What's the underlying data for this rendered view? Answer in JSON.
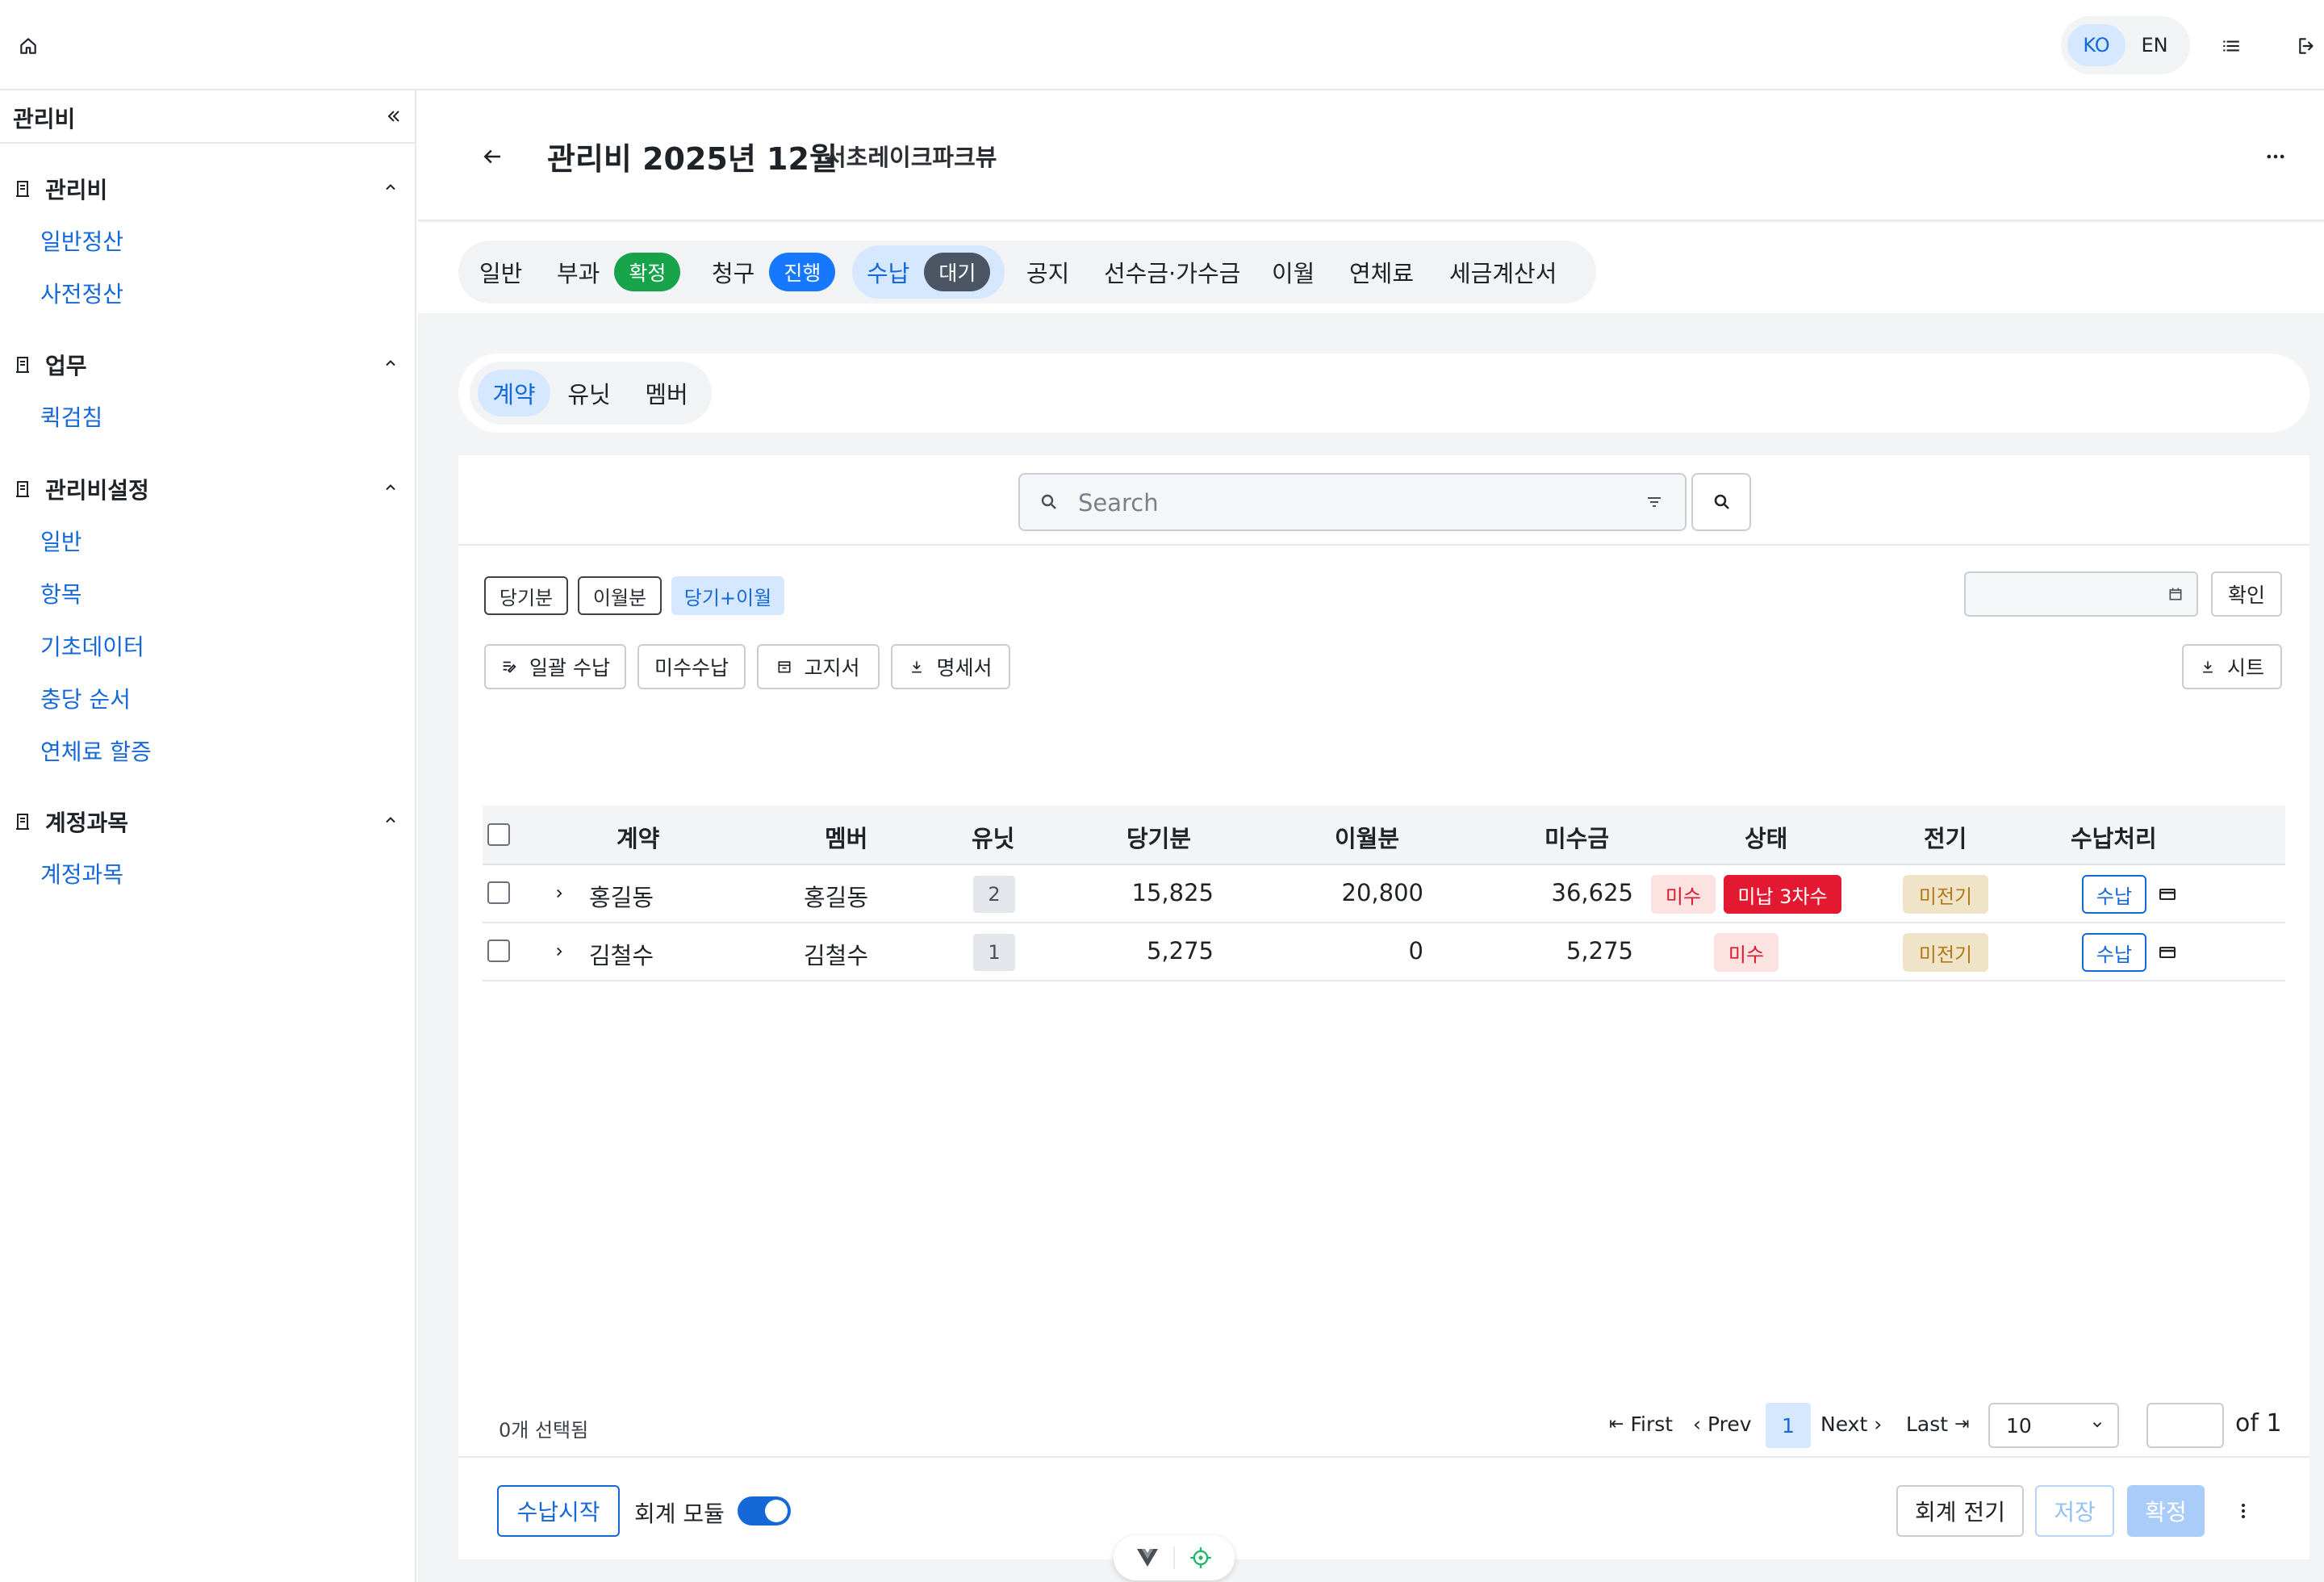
{
  "lang": {
    "ko": "KO",
    "en": "EN"
  },
  "sidebar": {
    "title": "관리비",
    "groups": [
      {
        "label": "관리비",
        "items": [
          "일반정산",
          "사전정산"
        ]
      },
      {
        "label": "업무",
        "items": [
          "퀵검침"
        ]
      },
      {
        "label": "관리비설정",
        "items": [
          "일반",
          "항목",
          "기초데이터",
          "충당 순서",
          "연체료 할증"
        ]
      },
      {
        "label": "계정과목",
        "items": [
          "계정과목"
        ]
      }
    ]
  },
  "header": {
    "title": "관리비 2025년 12월",
    "subtitle": "서초레이크파크뷰"
  },
  "tabs": [
    {
      "label": "일반"
    },
    {
      "label": "부과",
      "badge": "확정"
    },
    {
      "label": "청구",
      "badge": "진행"
    },
    {
      "label": "수납",
      "badge": "대기"
    },
    {
      "label": "공지"
    },
    {
      "label": "선수금·가수금"
    },
    {
      "label": "이월"
    },
    {
      "label": "연체료"
    },
    {
      "label": "세금계산서"
    }
  ],
  "subtabs": [
    "계약",
    "유닛",
    "멤버"
  ],
  "search": {
    "placeholder": "Search"
  },
  "filters": {
    "current": "당기분",
    "carried": "이월분",
    "both": "당기+이월",
    "confirm": "확인"
  },
  "actions": {
    "bulk_pay": "일괄 수납",
    "unpaid_pay": "미수수납",
    "notice": "고지서",
    "statement": "명세서",
    "sheet": "시트"
  },
  "table": {
    "headers": [
      "계약",
      "멤버",
      "유닛",
      "당기분",
      "이월분",
      "미수금",
      "상태",
      "전기",
      "수납처리"
    ],
    "rows": [
      {
        "contract": "홍길동",
        "member": "홍길동",
        "unit": "2",
        "current": "15,825",
        "carried": "20,800",
        "unpaid": "36,625",
        "status": [
          "미수",
          "미납 3차수"
        ],
        "posting": "미전기",
        "action": "수납"
      },
      {
        "contract": "김철수",
        "member": "김철수",
        "unit": "1",
        "current": "5,275",
        "carried": "0",
        "unpaid": "5,275",
        "status": [
          "미수"
        ],
        "posting": "미전기",
        "action": "수납"
      }
    ]
  },
  "selection": "0개 선택됨",
  "pager": {
    "first": "First",
    "prev": "Prev",
    "page": "1",
    "next": "Next",
    "last": "Last",
    "page_size": "10",
    "of": "of 1"
  },
  "footer": {
    "start": "수납시작",
    "toggle_label": "회계 모듈",
    "toggle_on": true,
    "post": "회계 전기",
    "save": "저장",
    "confirm": "확정"
  },
  "colors": {
    "accent": "#1468d8",
    "green": "#16a34a",
    "blue": "#1677ff",
    "slate": "#4b5563",
    "red": "#e31932"
  }
}
